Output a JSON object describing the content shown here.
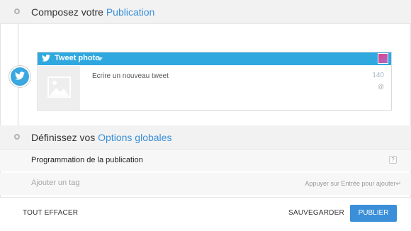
{
  "section_compose": {
    "title_prefix": "Composez votre",
    "title_highlight": "Publication"
  },
  "tweet_card": {
    "account_label": "Tweet photo",
    "placeholder": "Ecrire un nouveau tweet",
    "char_counter": "140",
    "at_symbol": "@"
  },
  "section_options": {
    "title_prefix": "Définissez vos",
    "title_highlight": "Options globales"
  },
  "scheduling": {
    "label": "Programmation de la publication",
    "help_glyph": "?"
  },
  "tag": {
    "placeholder": "Ajouter un tag",
    "hint": "Appuyer sur Entrée pour ajouter↵"
  },
  "footer": {
    "clear_label": "TOUT EFFACER",
    "save_label": "SAUVEGARDER",
    "publish_label": "PUBLIER"
  },
  "colors": {
    "accent": "#3a8fd8",
    "twitter": "#2fa8e0"
  },
  "icons": {
    "twitter": "twitter-bird-icon",
    "media": "image-placeholder-icon"
  }
}
